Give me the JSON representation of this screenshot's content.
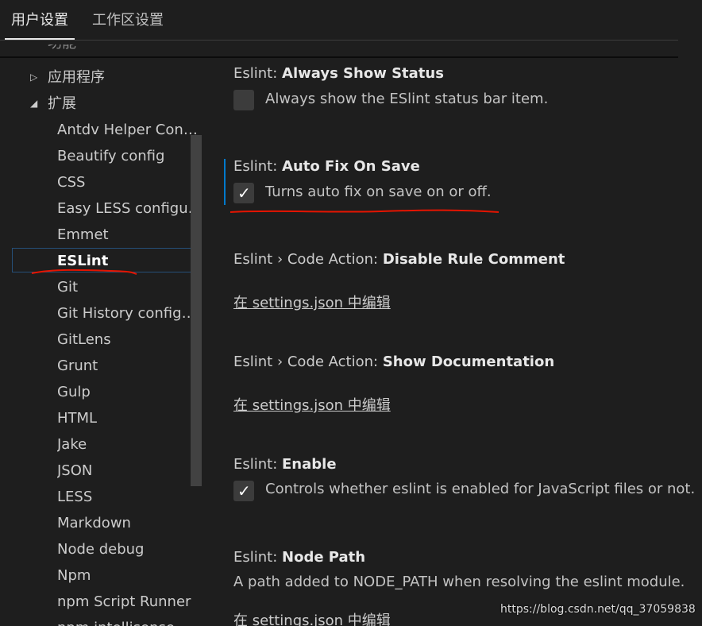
{
  "tabs": [
    {
      "label": "用户设置",
      "active": true
    },
    {
      "label": "工作区设置",
      "active": false
    }
  ],
  "tree": {
    "cut_label": "功能",
    "parents": [
      {
        "label": "应用程序",
        "expanded": false
      },
      {
        "label": "扩展",
        "expanded": true
      }
    ],
    "children": [
      "Antdv Helper Confi...",
      "Beautify config",
      "CSS",
      "Easy LESS configur...",
      "Emmet",
      "ESLint",
      "Git",
      "Git History configur...",
      "GitLens",
      "Grunt",
      "Gulp",
      "HTML",
      "Jake",
      "JSON",
      "LESS",
      "Markdown",
      "Node debug",
      "Npm",
      "npm Script Runner",
      "npm intellisense"
    ],
    "selected": "ESLint"
  },
  "settings": {
    "always_show_status": {
      "prefix": "Eslint: ",
      "name": "Always Show Status",
      "desc": "Always show the ESlint status bar item.",
      "checked": false
    },
    "auto_fix_on_save": {
      "prefix": "Eslint: ",
      "name": "Auto Fix On Save",
      "desc": "Turns auto fix on save on or off.",
      "checked": true
    },
    "disable_rule_comment": {
      "prefix": "Eslint › Code Action: ",
      "name": "Disable Rule Comment",
      "link": "在 settings.json 中编辑"
    },
    "show_documentation": {
      "prefix": "Eslint › Code Action: ",
      "name": "Show Documentation",
      "link": "在 settings.json 中编辑"
    },
    "enable": {
      "prefix": "Eslint: ",
      "name": "Enable",
      "desc": "Controls whether eslint is enabled for JavaScript files or not.",
      "checked": true
    },
    "node_path": {
      "prefix": "Eslint: ",
      "name": "Node Path",
      "desc": "A path added to NODE_PATH when resolving the eslint module.",
      "link": "在 settings.json 中编辑"
    }
  },
  "checkmark": "✓",
  "watermark": "https://blog.csdn.net/qq_37059838",
  "colors": {
    "accent": "#007acc",
    "annotation": "#e51400",
    "background": "#1e1e1e"
  }
}
